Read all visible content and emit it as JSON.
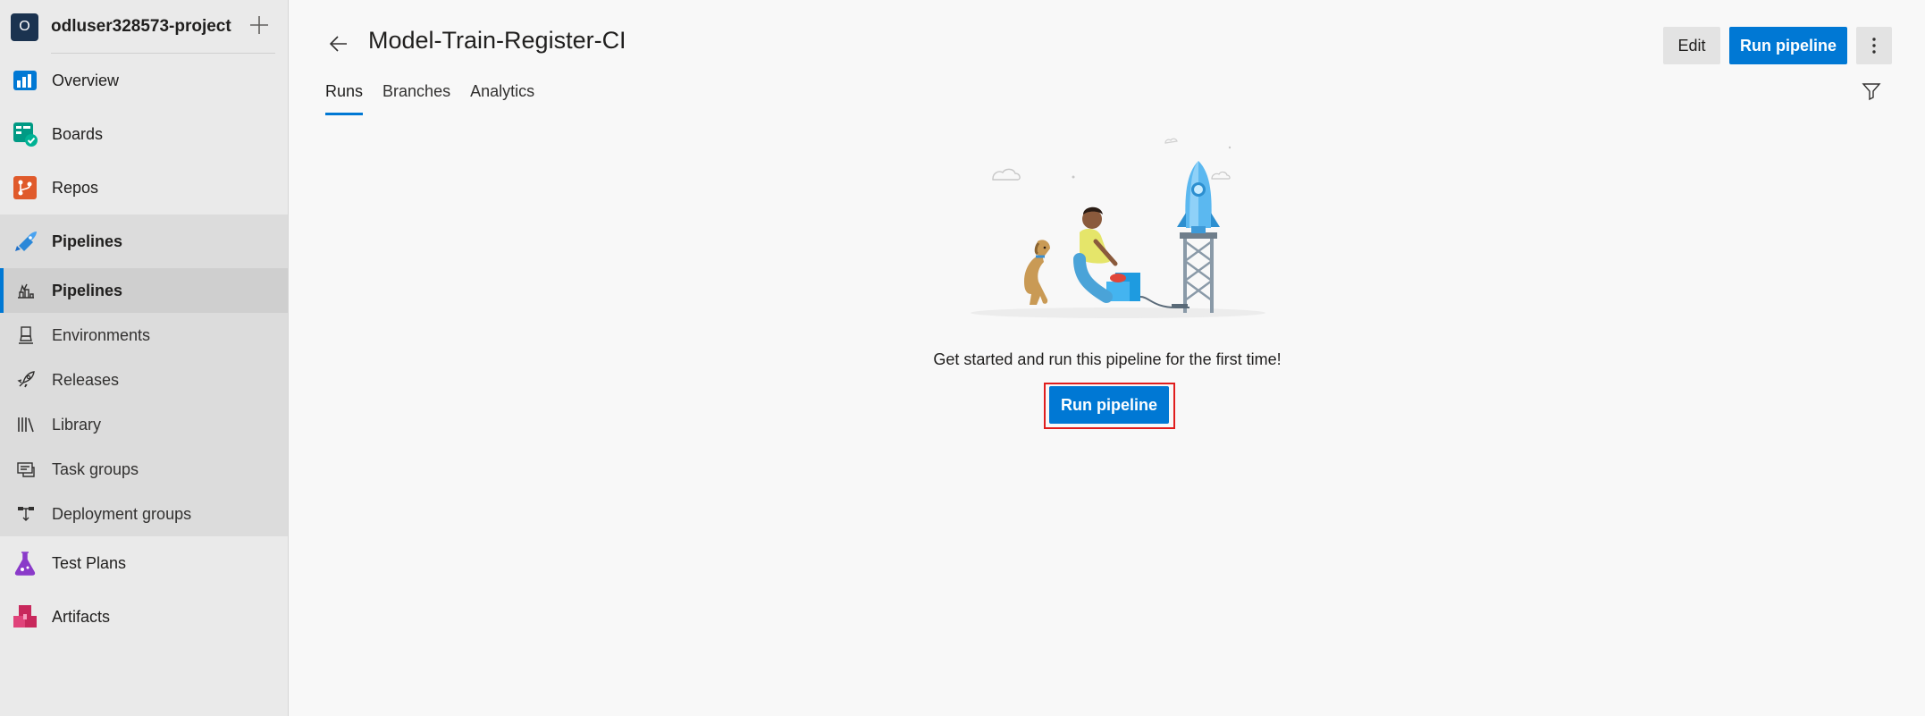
{
  "project": {
    "initial": "O",
    "name": "odluser328573-project"
  },
  "nav": {
    "overview": "Overview",
    "boards": "Boards",
    "repos": "Repos",
    "pipelines_group": "Pipelines",
    "pipelines_sub": [
      {
        "label": "Pipelines",
        "icon": "pipelines-sub-icon",
        "active": true
      },
      {
        "label": "Environments",
        "icon": "environments-icon"
      },
      {
        "label": "Releases",
        "icon": "rocket-icon"
      },
      {
        "label": "Library",
        "icon": "library-icon"
      },
      {
        "label": "Task groups",
        "icon": "task-groups-icon"
      },
      {
        "label": "Deployment groups",
        "icon": "deployment-groups-icon"
      }
    ],
    "test_plans": "Test Plans",
    "artifacts": "Artifacts"
  },
  "header": {
    "title": "Model-Train-Register-CI",
    "edit_label": "Edit",
    "run_label": "Run pipeline",
    "tabs": [
      "Runs",
      "Branches",
      "Analytics"
    ],
    "active_tab": "Runs"
  },
  "empty_state": {
    "message": "Get started and run this pipeline for the first time!",
    "run_label": "Run pipeline"
  },
  "colors": {
    "accent": "#0078d4",
    "highlight": "#e01d1d",
    "sidebar_bg": "#eaeaea"
  }
}
